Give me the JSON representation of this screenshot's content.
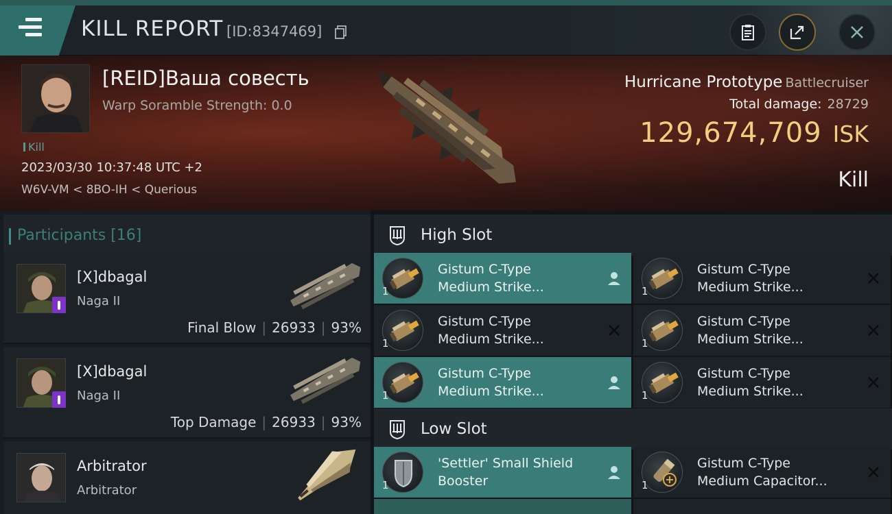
{
  "header": {
    "title": "KILL REPORT",
    "report_id": "[ID:8347469]",
    "accent_color": "#2e6f6b"
  },
  "victim": {
    "pilot_name": "[REID]Ваша совесть",
    "warp_scramble": "Warp Soramble Strength: 0.0",
    "type_tag": "Kill",
    "timestamp": "2023/03/30 10:37:48 UTC +2",
    "location": "W6V-VM < 8BO-IH < Querious",
    "ship_name": "Hurricane Prototype",
    "ship_class": "Battlecruiser",
    "total_damage_label": "Total damage:",
    "total_damage_value": "28729",
    "isk_value": "129,674,709",
    "isk_unit": "ISK",
    "result": "Kill"
  },
  "participants": {
    "label": "Participants [16]",
    "rows": [
      {
        "name": "[X]dbagal",
        "ship": "Naga II",
        "tag": "Final Blow",
        "damage": "26933",
        "percent": "93%",
        "badge": true
      },
      {
        "name": "[X]dbagal",
        "ship": "Naga II",
        "tag": "Top Damage",
        "damage": "26933",
        "percent": "93%",
        "badge": true
      },
      {
        "name": "Arbitrator",
        "ship": "Arbitrator",
        "tag": "",
        "damage": "",
        "percent": "",
        "badge": false
      }
    ]
  },
  "slots": {
    "high": {
      "label": "High Slot",
      "modules": [
        {
          "line1": "Gistum C-Type",
          "line2": "Medium Strike...",
          "qty": "1",
          "highlight": true,
          "action": "pilot-icon"
        },
        {
          "line1": "Gistum C-Type",
          "line2": "Medium Strike...",
          "qty": "1",
          "highlight": false,
          "action": "close-icon"
        },
        {
          "line1": "Gistum C-Type",
          "line2": "Medium Strike...",
          "qty": "1",
          "highlight": false,
          "action": "close-icon"
        },
        {
          "line1": "Gistum C-Type",
          "line2": "Medium Strike...",
          "qty": "1",
          "highlight": false,
          "action": "close-icon"
        },
        {
          "line1": "Gistum C-Type",
          "line2": "Medium Strike...",
          "qty": "1",
          "highlight": true,
          "action": "pilot-icon"
        },
        {
          "line1": "Gistum C-Type",
          "line2": "Medium Strike...",
          "qty": "1",
          "highlight": false,
          "action": "close-icon"
        }
      ]
    },
    "low": {
      "label": "Low Slot",
      "modules": [
        {
          "line1": "'Settler' Small Shield",
          "line2": "Booster",
          "qty": "1",
          "highlight": true,
          "action": "pilot-icon"
        },
        {
          "line1": "Gistum C-Type",
          "line2": "Medium Capacitor...",
          "qty": "1",
          "highlight": false,
          "action": "close-icon"
        }
      ]
    }
  }
}
